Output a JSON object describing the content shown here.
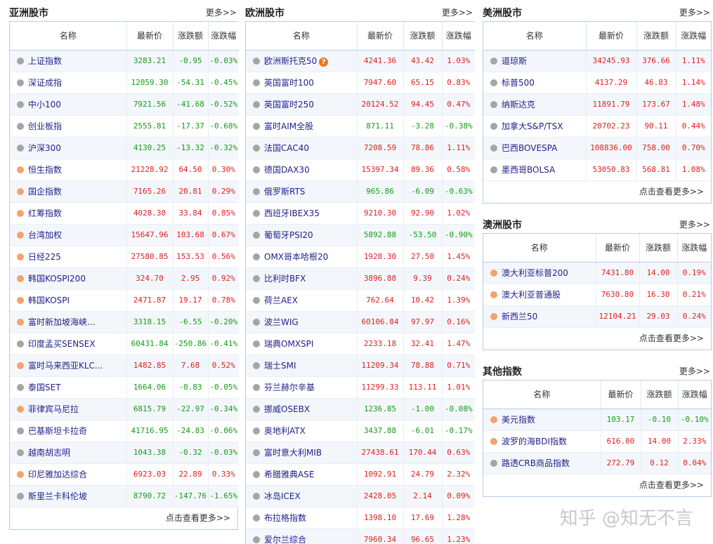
{
  "colors": {
    "up": "#e0201f",
    "down": "#199b19",
    "border": "#b6cde4"
  },
  "headers": {
    "name": "名称",
    "last": "最新价",
    "change": "涨跌额",
    "pct": "涨跌幅"
  },
  "asia": {
    "title": "亚洲股市",
    "more": "更多>>",
    "footer": "点击查看更多>>",
    "rows": [
      {
        "name": "上证指数",
        "dot": "gray",
        "last": "3283.21",
        "change": "-0.95",
        "pct": "-0.03%",
        "dir": "down"
      },
      {
        "name": "深证成指",
        "dot": "gray",
        "last": "12059.30",
        "change": "-54.31",
        "pct": "-0.45%",
        "dir": "down"
      },
      {
        "name": "中小100",
        "dot": "gray",
        "last": "7921.56",
        "change": "-41.68",
        "pct": "-0.52%",
        "dir": "down"
      },
      {
        "name": "创业板指",
        "dot": "gray",
        "last": "2555.81",
        "change": "-17.37",
        "pct": "-0.68%",
        "dir": "down"
      },
      {
        "name": "沪深300",
        "dot": "gray",
        "last": "4130.25",
        "change": "-13.32",
        "pct": "-0.32%",
        "dir": "down"
      },
      {
        "name": "恒生指数",
        "dot": "orange",
        "last": "21228.92",
        "change": "64.50",
        "pct": "0.30%",
        "dir": "up"
      },
      {
        "name": "国企指数",
        "dot": "orange",
        "last": "7165.26",
        "change": "20.81",
        "pct": "0.29%",
        "dir": "up"
      },
      {
        "name": "红筹指数",
        "dot": "orange",
        "last": "4028.30",
        "change": "33.84",
        "pct": "0.85%",
        "dir": "up"
      },
      {
        "name": "台湾加权",
        "dot": "orange",
        "last": "15647.96",
        "change": "103.68",
        "pct": "0.67%",
        "dir": "up"
      },
      {
        "name": "日经225",
        "dot": "orange",
        "last": "27580.85",
        "change": "153.53",
        "pct": "0.56%",
        "dir": "up"
      },
      {
        "name": "韩国KOSPI200",
        "dot": "orange",
        "last": "324.70",
        "change": "2.95",
        "pct": "0.92%",
        "dir": "up"
      },
      {
        "name": "韩国KOSPI",
        "dot": "orange",
        "last": "2471.87",
        "change": "19.17",
        "pct": "0.78%",
        "dir": "up"
      },
      {
        "name": "富时新加坡海峡...",
        "dot": "orange",
        "last": "3318.15",
        "change": "-6.55",
        "pct": "-0.20%",
        "dir": "down"
      },
      {
        "name": "印度孟买SENSEX",
        "dot": "gray",
        "last": "60431.84",
        "change": "-250.86",
        "pct": "-0.41%",
        "dir": "down"
      },
      {
        "name": "富时马来西亚KLC...",
        "dot": "orange",
        "last": "1482.85",
        "change": "7.68",
        "pct": "0.52%",
        "dir": "up"
      },
      {
        "name": "泰国SET",
        "dot": "gray",
        "last": "1664.06",
        "change": "-0.83",
        "pct": "-0.05%",
        "dir": "down"
      },
      {
        "name": "菲律宾马尼拉",
        "dot": "orange",
        "last": "6815.79",
        "change": "-22.97",
        "pct": "-0.34%",
        "dir": "down"
      },
      {
        "name": "巴基斯坦卡拉奇",
        "dot": "gray",
        "last": "41716.95",
        "change": "-24.83",
        "pct": "-0.06%",
        "dir": "down"
      },
      {
        "name": "越南胡志明",
        "dot": "gray",
        "last": "1043.38",
        "change": "-0.32",
        "pct": "-0.03%",
        "dir": "down"
      },
      {
        "name": "印尼雅加达综合",
        "dot": "orange",
        "last": "6923.03",
        "change": "22.89",
        "pct": "0.33%",
        "dir": "up"
      },
      {
        "name": "斯里兰卡科伦坡",
        "dot": "gray",
        "last": "8790.72",
        "change": "-147.76",
        "pct": "-1.65%",
        "dir": "down"
      }
    ]
  },
  "europe": {
    "title": "欧洲股市",
    "more": "更多>>",
    "rows": [
      {
        "name": "欧洲斯托克50",
        "dot": "gray",
        "last": "4241.36",
        "change": "43.42",
        "pct": "1.03%",
        "dir": "up",
        "badge": "?"
      },
      {
        "name": "英国富时100",
        "dot": "gray",
        "last": "7947.60",
        "change": "65.15",
        "pct": "0.83%",
        "dir": "up"
      },
      {
        "name": "英国富时250",
        "dot": "gray",
        "last": "20124.52",
        "change": "94.45",
        "pct": "0.47%",
        "dir": "up"
      },
      {
        "name": "富时AIM全股",
        "dot": "gray",
        "last": "871.11",
        "change": "-3.28",
        "pct": "-0.38%",
        "dir": "down"
      },
      {
        "name": "法国CAC40",
        "dot": "gray",
        "last": "7208.59",
        "change": "78.86",
        "pct": "1.11%",
        "dir": "up"
      },
      {
        "name": "德国DAX30",
        "dot": "gray",
        "last": "15397.34",
        "change": "89.36",
        "pct": "0.58%",
        "dir": "up"
      },
      {
        "name": "俄罗斯RTS",
        "dot": "gray",
        "last": "965.86",
        "change": "-6.09",
        "pct": "-0.63%",
        "dir": "down"
      },
      {
        "name": "西班牙IBEX35",
        "dot": "gray",
        "last": "9210.30",
        "change": "92.90",
        "pct": "1.02%",
        "dir": "up"
      },
      {
        "name": "葡萄牙PSI20",
        "dot": "gray",
        "last": "5892.88",
        "change": "-53.50",
        "pct": "-0.90%",
        "dir": "down"
      },
      {
        "name": "OMX哥本哈根20",
        "dot": "gray",
        "last": "1928.30",
        "change": "27.50",
        "pct": "1.45%",
        "dir": "up"
      },
      {
        "name": "比利时BFX",
        "dot": "gray",
        "last": "3896.88",
        "change": "9.39",
        "pct": "0.24%",
        "dir": "up"
      },
      {
        "name": "荷兰AEX",
        "dot": "gray",
        "last": "762.64",
        "change": "10.42",
        "pct": "1.39%",
        "dir": "up"
      },
      {
        "name": "波兰WIG",
        "dot": "gray",
        "last": "60106.84",
        "change": "97.97",
        "pct": "0.16%",
        "dir": "up"
      },
      {
        "name": "瑞典OMXSPI",
        "dot": "gray",
        "last": "2233.18",
        "change": "32.41",
        "pct": "1.47%",
        "dir": "up"
      },
      {
        "name": "瑞士SMI",
        "dot": "gray",
        "last": "11209.34",
        "change": "78.88",
        "pct": "0.71%",
        "dir": "up"
      },
      {
        "name": "芬兰赫尔辛基",
        "dot": "gray",
        "last": "11299.33",
        "change": "113.11",
        "pct": "1.01%",
        "dir": "up"
      },
      {
        "name": "挪威OSEBX",
        "dot": "gray",
        "last": "1236.85",
        "change": "-1.00",
        "pct": "-0.08%",
        "dir": "down"
      },
      {
        "name": "奥地利ATX",
        "dot": "gray",
        "last": "3437.88",
        "change": "-6.01",
        "pct": "-0.17%",
        "dir": "down"
      },
      {
        "name": "富时意大利MIB",
        "dot": "gray",
        "last": "27438.61",
        "change": "170.44",
        "pct": "0.63%",
        "dir": "up"
      },
      {
        "name": "希腊雅典ASE",
        "dot": "gray",
        "last": "1092.91",
        "change": "24.79",
        "pct": "2.32%",
        "dir": "up"
      },
      {
        "name": "冰岛ICEX",
        "dot": "gray",
        "last": "2428.05",
        "change": "2.14",
        "pct": "0.09%",
        "dir": "up"
      },
      {
        "name": "布拉格指数",
        "dot": "gray",
        "last": "1398.10",
        "change": "17.69",
        "pct": "1.28%",
        "dir": "up"
      },
      {
        "name": "爱尔兰综合",
        "dot": "gray",
        "last": "7960.34",
        "change": "96.65",
        "pct": "1.23%",
        "dir": "up"
      }
    ]
  },
  "america": {
    "title": "美洲股市",
    "more": "更多>>",
    "footer": "点击查看更多>>",
    "rows": [
      {
        "name": "道琼斯",
        "dot": "gray",
        "last": "34245.93",
        "change": "376.66",
        "pct": "1.11%",
        "dir": "up"
      },
      {
        "name": "标普500",
        "dot": "gray",
        "last": "4137.29",
        "change": "46.83",
        "pct": "1.14%",
        "dir": "up"
      },
      {
        "name": "纳斯达克",
        "dot": "gray",
        "last": "11891.79",
        "change": "173.67",
        "pct": "1.48%",
        "dir": "up"
      },
      {
        "name": "加拿大S&P/TSX",
        "dot": "gray",
        "last": "20702.23",
        "change": "90.11",
        "pct": "0.44%",
        "dir": "up"
      },
      {
        "name": "巴西BOVESPA",
        "dot": "gray",
        "last": "108836.00",
        "change": "758.00",
        "pct": "0.70%",
        "dir": "up"
      },
      {
        "name": "墨西哥BOLSA",
        "dot": "gray",
        "last": "53050.83",
        "change": "568.81",
        "pct": "1.08%",
        "dir": "up"
      }
    ]
  },
  "oceania": {
    "title": "澳洲股市",
    "more": "更多>>",
    "footer": "点击查看更多>>",
    "rows": [
      {
        "name": "澳大利亚标普200",
        "dot": "orange",
        "last": "7431.80",
        "change": "14.00",
        "pct": "0.19%",
        "dir": "up"
      },
      {
        "name": "澳大利亚普通股",
        "dot": "orange",
        "last": "7630.80",
        "change": "16.30",
        "pct": "0.21%",
        "dir": "up"
      },
      {
        "name": "新西兰50",
        "dot": "orange",
        "last": "12104.21",
        "change": "29.03",
        "pct": "0.24%",
        "dir": "up"
      }
    ]
  },
  "other": {
    "title": "其他指数",
    "more": "更多>>",
    "footer": "点击查看更多>>",
    "rows": [
      {
        "name": "美元指数",
        "dot": "orange",
        "last": "103.17",
        "change": "-0.10",
        "pct": "-0.10%",
        "dir": "down"
      },
      {
        "name": "波罗的海BDI指数",
        "dot": "orange",
        "last": "616.00",
        "change": "14.00",
        "pct": "2.33%",
        "dir": "up"
      },
      {
        "name": "路透CRB商品指数",
        "dot": "gray",
        "last": "272.79",
        "change": "0.12",
        "pct": "0.04%",
        "dir": "up"
      }
    ]
  },
  "watermark": "知乎 @知无不言"
}
